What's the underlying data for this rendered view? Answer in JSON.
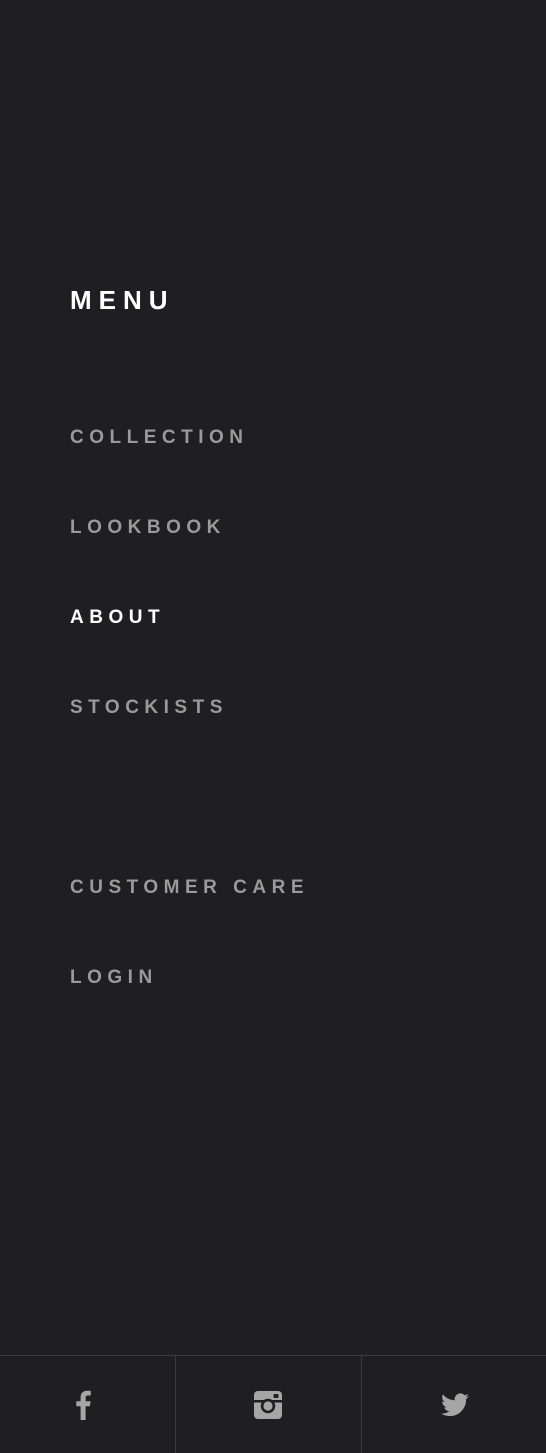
{
  "menu": {
    "title": "MENU",
    "primary_items": [
      {
        "label": "COLLECTION",
        "active": false
      },
      {
        "label": "LOOKBOOK",
        "active": false
      },
      {
        "label": "ABOUT",
        "active": true
      },
      {
        "label": "STOCKISTS",
        "active": false
      }
    ],
    "secondary_items": [
      {
        "label": "CUSTOMER CARE",
        "active": false
      },
      {
        "label": "LOGIN",
        "active": false
      }
    ]
  },
  "social": [
    {
      "icon": "facebook-icon"
    },
    {
      "icon": "instagram-icon"
    },
    {
      "icon": "twitter-icon"
    }
  ],
  "colors": {
    "background": "#1f1f21",
    "text_active": "#ffffff",
    "text_inactive": "#9a9a9a",
    "icon": "#a6a6a6",
    "divider": "#3b3b3d"
  }
}
